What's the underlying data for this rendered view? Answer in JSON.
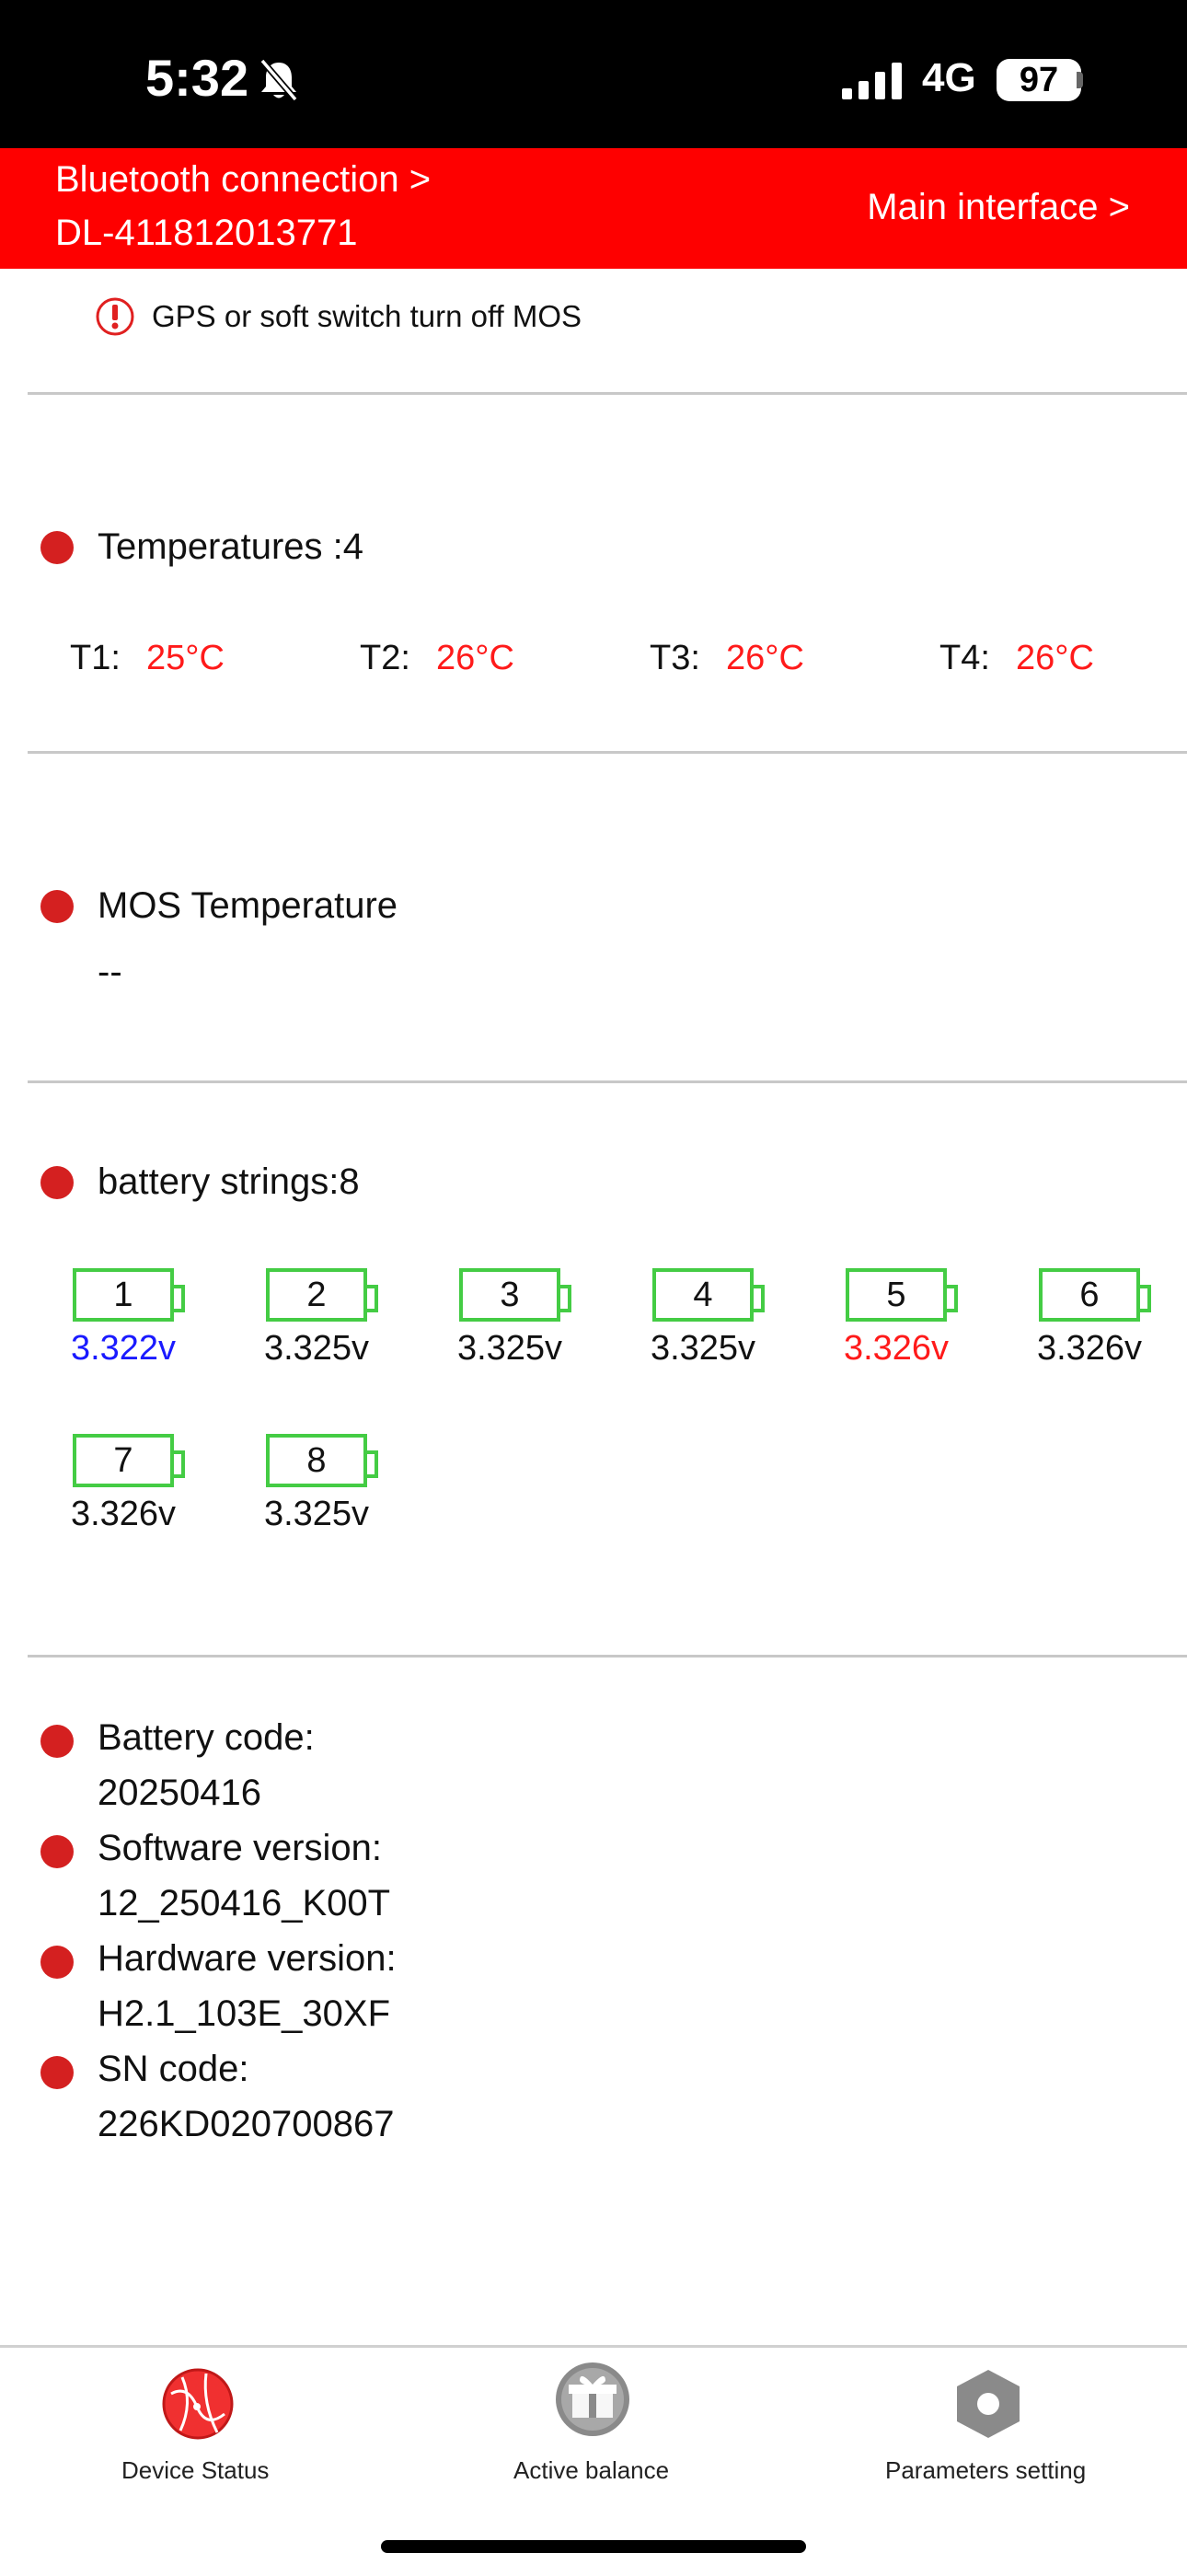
{
  "status_bar": {
    "time": "5:32",
    "network": "4G",
    "battery": "97"
  },
  "header": {
    "bluetooth_line1": "Bluetooth connection >",
    "bluetooth_line2": "DL-411812013771",
    "main_interface": "Main interface >"
  },
  "warning": {
    "text": "GPS or soft switch turn off MOS"
  },
  "temperatures": {
    "title": "Temperatures :4",
    "items": [
      {
        "label": "T1:",
        "value": "25°C"
      },
      {
        "label": "T2:",
        "value": "26°C"
      },
      {
        "label": "T3:",
        "value": "26°C"
      },
      {
        "label": "T4:",
        "value": "26°C"
      }
    ]
  },
  "mos_temperature": {
    "title": "MOS Temperature",
    "value": "--"
  },
  "battery_strings": {
    "title": "battery strings:8",
    "cells": [
      {
        "number": "1",
        "voltage": "3.322v",
        "color": "#1a1aff"
      },
      {
        "number": "2",
        "voltage": "3.325v",
        "color": "#111111"
      },
      {
        "number": "3",
        "voltage": "3.325v",
        "color": "#111111"
      },
      {
        "number": "4",
        "voltage": "3.325v",
        "color": "#111111"
      },
      {
        "number": "5",
        "voltage": "3.326v",
        "color": "#ff1a1a"
      },
      {
        "number": "6",
        "voltage": "3.326v",
        "color": "#111111"
      },
      {
        "number": "7",
        "voltage": "3.326v",
        "color": "#111111"
      },
      {
        "number": "8",
        "voltage": "3.325v",
        "color": "#111111"
      }
    ]
  },
  "info": {
    "battery_code_label": "Battery code:",
    "battery_code": "20250416",
    "software_label": "Software version:",
    "software": "12_250416_K00T",
    "hardware_label": "Hardware version:",
    "hardware": "H2.1_103E_30XF",
    "sn_label": "SN code:",
    "sn": "226KD020700867"
  },
  "tabs": {
    "device_status": "Device Status",
    "active_balance": "Active balance",
    "parameters_setting": "Parameters setting"
  },
  "colors": {
    "brand_red": "#fe0000",
    "dot_red": "#d42020",
    "cell_green": "#44cc44"
  }
}
